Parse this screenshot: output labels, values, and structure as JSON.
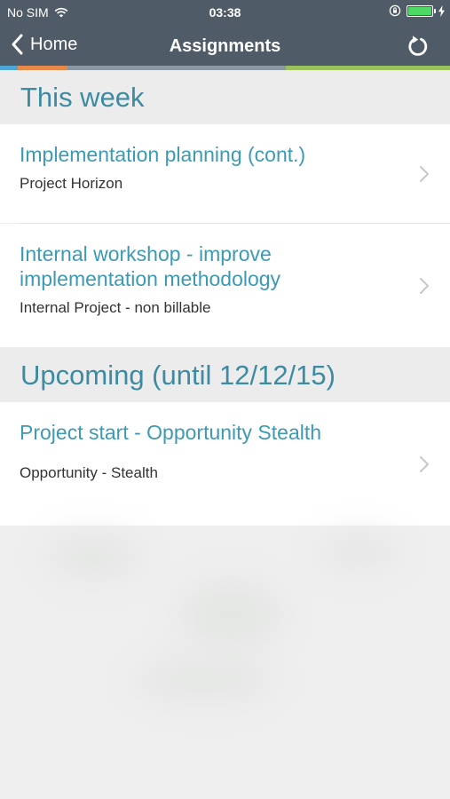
{
  "status_bar": {
    "carrier": "No SIM",
    "time": "03:38",
    "icons": [
      "wifi-icon",
      "orientation-lock-icon",
      "battery-icon",
      "charging-icon"
    ],
    "battery_level": 1.0
  },
  "nav": {
    "back_label": "Home",
    "title": "Assignments",
    "refresh_icon": "refresh-icon"
  },
  "colors": {
    "header_bg": "#4f5b66",
    "accent": "#3c9ab4",
    "section_text": "#3c8ba3",
    "strip": [
      "#4ea6d8",
      "#e8894a",
      "#8a98a3",
      "#9bc25a"
    ]
  },
  "sections": [
    {
      "title": "This week",
      "items": [
        {
          "title": "Implementation planning (cont.)",
          "subtitle": "Project Horizon"
        },
        {
          "title": "Internal workshop - improve implementation methodology",
          "subtitle": "Internal Project - non billable"
        }
      ]
    },
    {
      "title": "Upcoming (until 12/12/15)",
      "items": [
        {
          "title": "Project start - Opportunity Stealth",
          "subtitle": "Opportunity - Stealth"
        }
      ]
    }
  ]
}
